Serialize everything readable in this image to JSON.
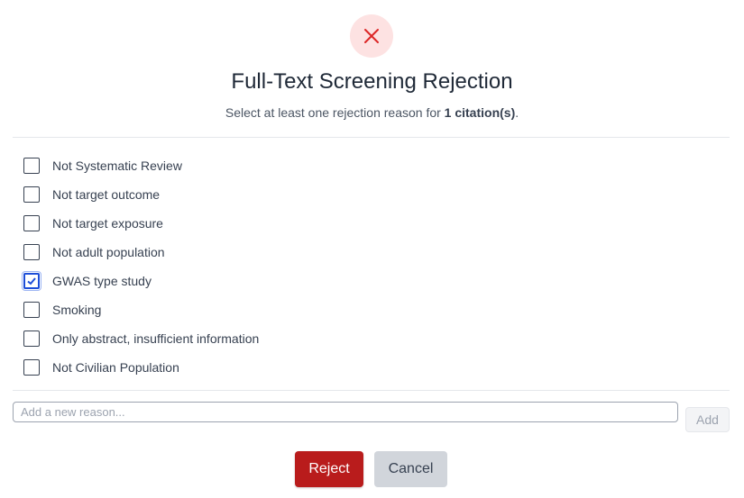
{
  "header": {
    "icon": "close-icon",
    "title": "Full-Text Screening Rejection",
    "subtitle_prefix": "Select at least one rejection reason for ",
    "subtitle_count": "1 citation(s)",
    "subtitle_suffix": "."
  },
  "reasons": [
    {
      "label": "Not Systematic Review",
      "checked": false
    },
    {
      "label": "Not target outcome",
      "checked": false
    },
    {
      "label": "Not target exposure",
      "checked": false
    },
    {
      "label": "Not adult population",
      "checked": false
    },
    {
      "label": "GWAS type study",
      "checked": true
    },
    {
      "label": "Smoking",
      "checked": false
    },
    {
      "label": "Only abstract, insufficient information",
      "checked": false
    },
    {
      "label": "Not Civilian Population",
      "checked": false
    }
  ],
  "new_reason": {
    "placeholder": "Add a new reason...",
    "value": "",
    "add_label": "Add"
  },
  "actions": {
    "reject_label": "Reject",
    "cancel_label": "Cancel"
  },
  "colors": {
    "reject": "#b91c1c",
    "icon_bg": "#fde2e2",
    "icon": "#dc2626",
    "checkbox_checked": "#1d4ed8"
  }
}
